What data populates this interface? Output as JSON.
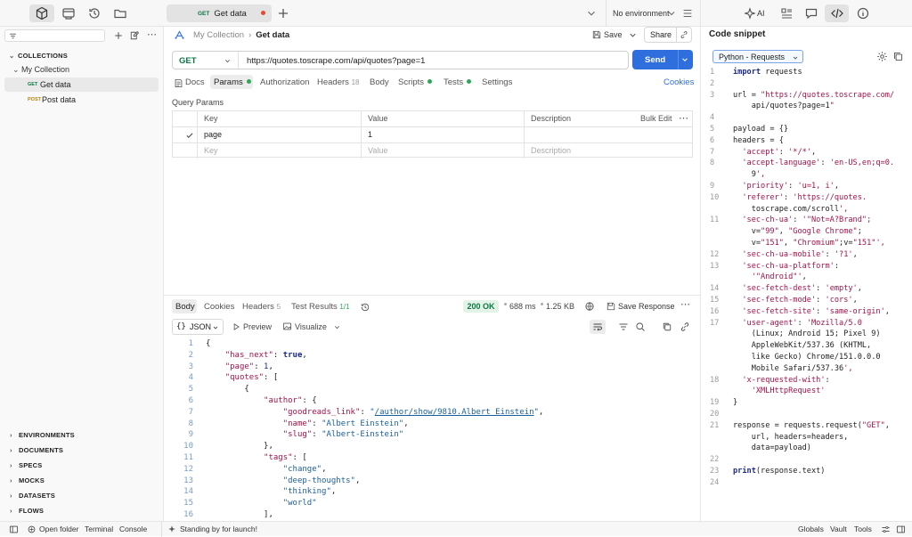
{
  "tabs": [
    {
      "method": "GET",
      "label": "Get data"
    }
  ],
  "environment": "No environment",
  "right_tabs": {
    "ai": "AI"
  },
  "sidebar": {
    "collections_label": "COLLECTIONS",
    "collection_name": "My Collection",
    "items": [
      {
        "method": "GET",
        "label": "Get data"
      },
      {
        "method": "POST",
        "label": "Post data"
      }
    ],
    "sections": [
      "ENVIRONMENTS",
      "DOCUMENTS",
      "SPECS",
      "MOCKS",
      "DATASETS",
      "FLOWS"
    ]
  },
  "request": {
    "breadcrumb_collection": "My Collection",
    "breadcrumb_sep": "›",
    "breadcrumb_request": "Get data",
    "save_label": "Save",
    "share_label": "Share",
    "method": "GET",
    "url": "https://quotes.toscrape.com/api/quotes?page=1",
    "send_label": "Send",
    "tabs": [
      {
        "label": "Docs"
      },
      {
        "label": "Params"
      },
      {
        "label": "Authorization"
      },
      {
        "label": "Headers",
        "count": "18"
      },
      {
        "label": "Body"
      },
      {
        "label": "Scripts"
      },
      {
        "label": "Tests"
      },
      {
        "label": "Settings"
      }
    ],
    "cookies_label": "Cookies",
    "query_params_label": "Query Params",
    "columns": {
      "key": "Key",
      "value": "Value",
      "description": "Description",
      "bulk_edit": "Bulk Edit"
    },
    "params": [
      {
        "key": "page",
        "value": "1",
        "checked": true
      }
    ],
    "placeholders": {
      "key": "Key",
      "value": "Value",
      "description": "Description"
    }
  },
  "response": {
    "tabs": [
      {
        "label": "Body"
      },
      {
        "label": "Cookies"
      },
      {
        "label": "Headers",
        "count": "5"
      },
      {
        "label": "Test Results",
        "count": "1/1"
      }
    ],
    "status": "200 OK",
    "time": "688 ms",
    "size": "1.25 KB",
    "save_response": "Save Response",
    "format": "JSON",
    "preview_label": "Preview",
    "visualize_label": "Visualize",
    "body_lines": [
      {
        "n": "1",
        "t": "{"
      },
      {
        "n": "2",
        "t": "    \"has_next\": true,"
      },
      {
        "n": "3",
        "t": "    \"page\": 1,"
      },
      {
        "n": "4",
        "t": "    \"quotes\": ["
      },
      {
        "n": "5",
        "t": "        {"
      },
      {
        "n": "6",
        "t": "            \"author\": {"
      },
      {
        "n": "7",
        "t": "                \"goodreads_link\": \"/author/show/9810.Albert_Einstein\","
      },
      {
        "n": "8",
        "t": "                \"name\": \"Albert Einstein\","
      },
      {
        "n": "9",
        "t": "                \"slug\": \"Albert-Einstein\""
      },
      {
        "n": "10",
        "t": "            },"
      },
      {
        "n": "11",
        "t": "            \"tags\": ["
      },
      {
        "n": "12",
        "t": "                \"change\","
      },
      {
        "n": "13",
        "t": "                \"deep-thoughts\","
      },
      {
        "n": "14",
        "t": "                \"thinking\","
      },
      {
        "n": "15",
        "t": "                \"world\""
      },
      {
        "n": "16",
        "t": "            ],"
      }
    ]
  },
  "snippet": {
    "title": "Code snippet",
    "language": "Python - Requests",
    "lines": [
      {
        "n": "1",
        "rows": [
          "import requests"
        ]
      },
      {
        "n": "2",
        "rows": [
          ""
        ]
      },
      {
        "n": "3",
        "rows": [
          "url = \"https://quotes.toscrape.com/",
          "    api/quotes?page=1\""
        ]
      },
      {
        "n": "4",
        "rows": [
          ""
        ]
      },
      {
        "n": "5",
        "rows": [
          "payload = {}"
        ]
      },
      {
        "n": "6",
        "rows": [
          "headers = {"
        ]
      },
      {
        "n": "7",
        "rows": [
          "  'accept': '*/*',"
        ]
      },
      {
        "n": "8",
        "rows": [
          "  'accept-language': 'en-US,en;q=0.",
          "    9',"
        ]
      },
      {
        "n": "9",
        "rows": [
          "  'priority': 'u=1, i',"
        ]
      },
      {
        "n": "10",
        "rows": [
          "  'referer': 'https://quotes.",
          "    toscrape.com/scroll',"
        ]
      },
      {
        "n": "11",
        "rows": [
          "  'sec-ch-ua': '\"Not=A?Brand\";",
          "    v=\"99\", \"Google Chrome\";",
          "    v=\"151\", \"Chromium\";v=\"151\"',"
        ]
      },
      {
        "n": "12",
        "rows": [
          "  'sec-ch-ua-mobile': '?1',"
        ]
      },
      {
        "n": "13",
        "rows": [
          "  'sec-ch-ua-platform':",
          "    '\"Android\"',"
        ]
      },
      {
        "n": "14",
        "rows": [
          "  'sec-fetch-dest': 'empty',"
        ]
      },
      {
        "n": "15",
        "rows": [
          "  'sec-fetch-mode': 'cors',"
        ]
      },
      {
        "n": "16",
        "rows": [
          "  'sec-fetch-site': 'same-origin',"
        ]
      },
      {
        "n": "17",
        "rows": [
          "  'user-agent': 'Mozilla/5.0",
          "    (Linux; Android 15; Pixel 9)",
          "    AppleWebKit/537.36 (KHTML,",
          "    like Gecko) Chrome/151.0.0.0",
          "    Mobile Safari/537.36',"
        ]
      },
      {
        "n": "18",
        "rows": [
          "  'x-requested-with':",
          "    'XMLHttpRequest'"
        ]
      },
      {
        "n": "19",
        "rows": [
          "}"
        ]
      },
      {
        "n": "20",
        "rows": [
          ""
        ]
      },
      {
        "n": "21",
        "rows": [
          "response = requests.request(\"GET\",",
          "    url, headers=headers,",
          "    data=payload)"
        ]
      },
      {
        "n": "22",
        "rows": [
          ""
        ]
      },
      {
        "n": "23",
        "rows": [
          "print(response.text)"
        ]
      },
      {
        "n": "24",
        "rows": [
          ""
        ]
      }
    ]
  },
  "statusbar": {
    "open_folder": "Open folder",
    "terminal": "Terminal",
    "console": "Console",
    "message": "Standing by for launch!",
    "globals": "Globals",
    "vault": "Vault",
    "tools": "Tools"
  },
  "colors": {
    "accent": "#2f6fdd",
    "get": "#0c7a43",
    "post": "#b5830b",
    "green": "#2fa55a"
  }
}
